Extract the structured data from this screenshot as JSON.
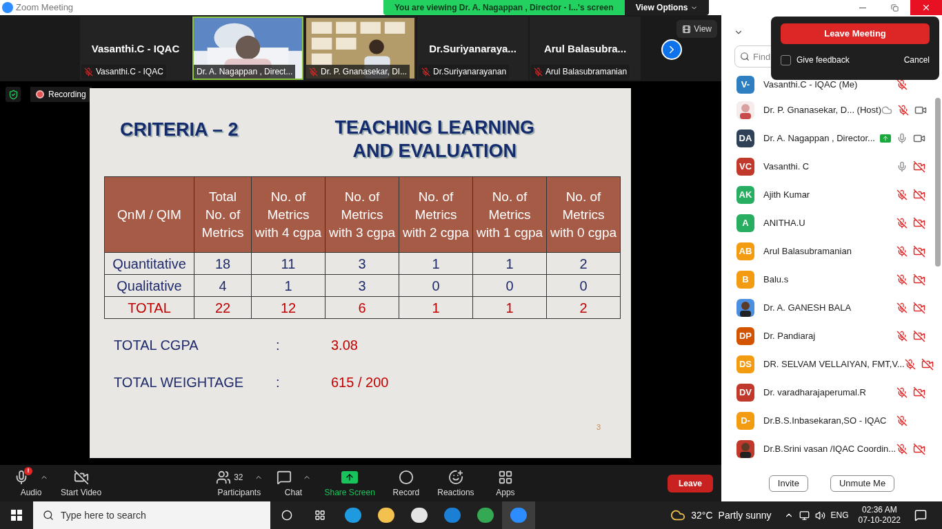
{
  "window": {
    "title": "Zoom Meeting"
  },
  "share_banner": {
    "text": "You are viewing Dr. A. Nagappan , Director - I...'s screen",
    "options": "View Options"
  },
  "video_strip": [
    {
      "kind": "name",
      "title": "Vasanthi.C - IQAC",
      "label": "Vasanthi.C - IQAC",
      "muted": true,
      "active": false
    },
    {
      "kind": "video",
      "label": "Dr. A. Nagappan , Direct...",
      "muted": false,
      "active": true
    },
    {
      "kind": "video",
      "label": "Dr. P. Gnanasekar, DI...",
      "muted": true,
      "active": false
    },
    {
      "kind": "name",
      "title": "Dr.Suriyanaraya...",
      "label": "Dr.Suriyanarayanan",
      "muted": true,
      "active": false
    },
    {
      "kind": "name",
      "title": "Arul  Balasubra...",
      "label": "Arul Balasubramanian",
      "muted": true,
      "active": false
    }
  ],
  "view_button": "View",
  "recording": "Recording",
  "slide": {
    "title_left": "CRITERIA – 2",
    "title_right": [
      "TEACHING LEARNING",
      "AND EVALUATION"
    ],
    "table": {
      "columns": [
        "QnM / QIM",
        "Total No. of Metrics",
        "No. of Metrics with 4 cgpa",
        "No. of Metrics with 3 cgpa",
        "No. of Metrics with 2 cgpa",
        "No. of Metrics with 1 cgpa",
        "No. of Metrics with 0 cgpa"
      ],
      "rows": [
        {
          "kind": "normal",
          "cells": [
            "Quantitative",
            "18",
            "11",
            "3",
            "1",
            "1",
            "2"
          ]
        },
        {
          "kind": "normal",
          "cells": [
            "Qualitative",
            "4",
            "1",
            "3",
            "0",
            "0",
            "0"
          ]
        },
        {
          "kind": "total",
          "cells": [
            "TOTAL",
            "22",
            "12",
            "6",
            "1",
            "1",
            "2"
          ]
        }
      ]
    },
    "summary": [
      {
        "label": "TOTAL CGPA",
        "sep": ":",
        "value": "3.08"
      },
      {
        "label": "TOTAL WEIGHTAGE",
        "sep": ":",
        "value": "615 / 200"
      }
    ],
    "page": "3"
  },
  "toolbar": [
    {
      "kind": "audio",
      "label": "Audio",
      "alert": "!",
      "caret": true
    },
    {
      "kind": "video",
      "label": "Start Video",
      "caret": false
    },
    {
      "kind": "participants",
      "label": "Participants",
      "count": "32",
      "caret": true
    },
    {
      "kind": "chat",
      "label": "Chat",
      "caret": true
    },
    {
      "kind": "share",
      "label": "Share Screen",
      "caret": false
    },
    {
      "kind": "record",
      "label": "Record",
      "caret": false
    },
    {
      "kind": "reactions",
      "label": "Reactions",
      "caret": false
    },
    {
      "kind": "apps",
      "label": "Apps",
      "caret": false
    }
  ],
  "leave_button": "Leave",
  "participants_panel": {
    "search": {
      "placeholder": "Find"
    },
    "participants": [
      {
        "name": "Vasanthi.C - IQAC (Me)",
        "kind": "initials",
        "initials": "V-",
        "color": "#2d7fc1",
        "muted": true
      },
      {
        "name": "Dr. P. Gnanasekar, D... (Host)",
        "kind": "picture",
        "muted": true,
        "video_off": false,
        "recording": true
      },
      {
        "name": "Dr. A. Nagappan , Director...",
        "kind": "initials",
        "initials": "DA",
        "color": "#2f4157",
        "muted": false,
        "video_off": false,
        "sharing": true
      },
      {
        "name": "Vasanthi. C",
        "kind": "initials",
        "initials": "VC",
        "color": "#c0392b",
        "muted": false,
        "video_off": true
      },
      {
        "name": "Ajith Kumar",
        "kind": "initials",
        "initials": "AK",
        "color": "#27ae60",
        "muted": true,
        "video_off": true
      },
      {
        "name": "ANITHA.U",
        "kind": "initials",
        "initials": "A",
        "color": "#27ae60",
        "muted": true,
        "video_off": true
      },
      {
        "name": "Arul Balasubramanian",
        "kind": "initials",
        "initials": "AB",
        "color": "#f39c12",
        "muted": true,
        "video_off": true
      },
      {
        "name": "Balu.s",
        "kind": "initials",
        "initials": "B",
        "color": "#f39c12",
        "muted": true,
        "video_off": true
      },
      {
        "name": "Dr. A. GANESH BALA",
        "kind": "picture",
        "muted": true,
        "video_off": true
      },
      {
        "name": "Dr. Pandiaraj",
        "kind": "initials",
        "initials": "DP",
        "color": "#d35400",
        "muted": true,
        "video_off": true
      },
      {
        "name": "DR. SELVAM VELLAIYAN, FMT,V...",
        "kind": "initials",
        "initials": "DS",
        "color": "#f39c12",
        "muted": true,
        "video_off": true
      },
      {
        "name": "Dr. varadharajaperumal.R",
        "kind": "initials",
        "initials": "DV",
        "color": "#c0392b",
        "muted": true,
        "video_off": true
      },
      {
        "name": "Dr.B.S.Inbasekaran,SO - IQAC",
        "kind": "initials",
        "initials": "D-",
        "color": "#f39c12",
        "muted": true
      },
      {
        "name": "Dr.B.Srini vasan /IQAC Coordin...",
        "kind": "picture",
        "muted": true,
        "video_off": true
      }
    ],
    "buttons": [
      "Invite",
      "Unmute Me"
    ]
  },
  "leave_popup": {
    "leave": "Leave Meeting",
    "feedback": {
      "label": "Give feedback",
      "checked": false
    },
    "cancel": "Cancel"
  },
  "taskbar": {
    "search": {
      "placeholder": "Type here to search"
    },
    "weather": {
      "temp": "32°C",
      "text": "Partly sunny"
    },
    "language": "ENG",
    "time": "02:36 AM",
    "date": "07-10-2022"
  }
}
